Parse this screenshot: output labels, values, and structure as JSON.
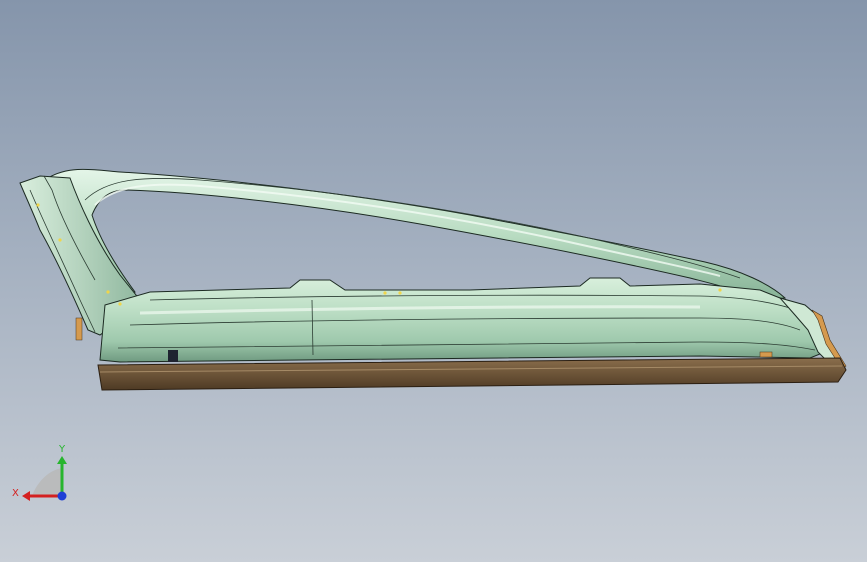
{
  "viewport": {
    "background_top": "#8595ab",
    "background_bottom": "#c9cfd7"
  },
  "model": {
    "part": "car-door-frame",
    "body_color": "#c8e6cf",
    "shadow_color": "#7fa890",
    "edge_color": "#1c2a22",
    "sill_color": "#6e5538"
  },
  "triad": {
    "x_label": "X",
    "y_label": "Y",
    "x_color": "#d42020",
    "y_color": "#27b52e",
    "z_color": "#1f3fd6"
  }
}
